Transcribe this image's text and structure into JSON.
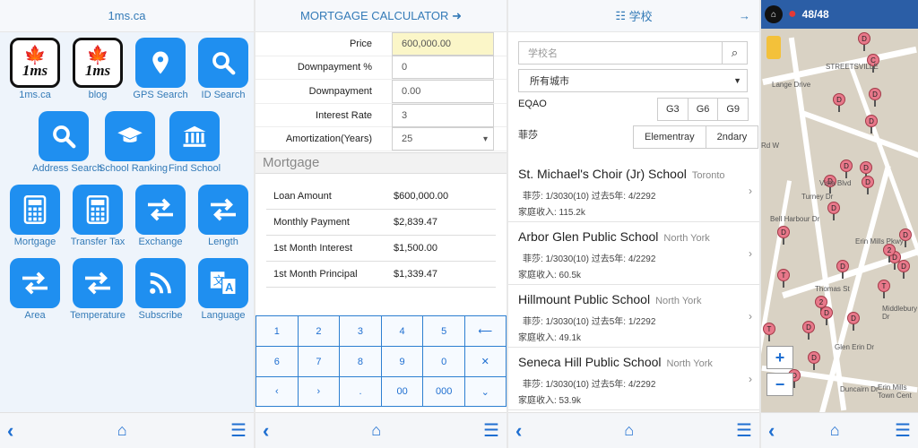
{
  "panel1": {
    "title": "1ms.ca",
    "tiles": [
      {
        "label": "1ms.ca",
        "icon": "maple-logo-icon"
      },
      {
        "label": "blog",
        "icon": "maple-logo-icon"
      },
      {
        "label": "GPS Search",
        "icon": "location-pin-icon"
      },
      {
        "label": "ID Search",
        "icon": "search-icon"
      },
      {
        "label": "Address Search",
        "icon": "search-icon"
      },
      {
        "label": "School Ranking",
        "icon": "graduation-cap-icon"
      },
      {
        "label": "Find School",
        "icon": "institution-icon"
      },
      {
        "label": "Mortgage",
        "icon": "calculator-icon"
      },
      {
        "label": "Transfer Tax",
        "icon": "calculator-icon"
      },
      {
        "label": "Exchange",
        "icon": "exchange-arrows-icon"
      },
      {
        "label": "Length",
        "icon": "exchange-arrows-icon"
      },
      {
        "label": "Area",
        "icon": "exchange-arrows-icon"
      },
      {
        "label": "Temperature",
        "icon": "exchange-arrows-icon"
      },
      {
        "label": "Subscribe",
        "icon": "rss-icon"
      },
      {
        "label": "Language",
        "icon": "translate-icon"
      }
    ],
    "logo_text": "1ms"
  },
  "panel2": {
    "title": "MORTGAGE CALCULATOR",
    "fields": [
      {
        "label": "Price",
        "value": "600,000.00"
      },
      {
        "label": "Downpayment %",
        "value": "0"
      },
      {
        "label": "Downpayment",
        "value": "0.00"
      },
      {
        "label": "Interest Rate",
        "value": "3"
      },
      {
        "label": "Amortization(Years)",
        "value": "25"
      }
    ],
    "section": "Mortgage",
    "results": [
      {
        "label": "Loan Amount",
        "value": "$600,000.00"
      },
      {
        "label": "Monthly Payment",
        "value": "$2,839.47"
      },
      {
        "label": "1st Month Interest",
        "value": "$1,500.00"
      },
      {
        "label": "1st Month Principal",
        "value": "$1,339.47"
      }
    ],
    "keys": [
      [
        "1",
        "2",
        "3",
        "4",
        "5",
        "⟵"
      ],
      [
        "6",
        "7",
        "8",
        "9",
        "0",
        "✕"
      ],
      [
        "‹",
        "›",
        ".",
        "00",
        "000",
        "⌄"
      ]
    ]
  },
  "panel3": {
    "title": "学校",
    "search_placeholder": "学校名",
    "city": "所有城市",
    "eqao_label": "EQAO",
    "grades": [
      "G3",
      "G6",
      "G9"
    ],
    "fraser_label": "菲莎",
    "levels": [
      "Elementray",
      "2ndary"
    ],
    "schools": [
      {
        "name": "St. Michael's Choir (Jr) School",
        "city": "Toronto",
        "line1": "菲莎: 1/3030(10)   过去5年: 4/2292",
        "line2": "家庭收入: 115.2k"
      },
      {
        "name": "Arbor Glen Public School",
        "city": "North York",
        "line1": "菲莎: 1/3030(10)   过去5年: 4/2292",
        "line2": "家庭收入: 60.5k"
      },
      {
        "name": "Hillmount Public School",
        "city": "North York",
        "line1": "菲莎: 1/3030(10)   过去5年: 1/2292",
        "line2": "家庭收入: 49.1k"
      },
      {
        "name": "Seneca Hill Public School",
        "city": "North York",
        "line1": "菲莎: 1/3030(10)   过去5年: 4/2292",
        "line2": "家庭收入: 53.9k"
      }
    ]
  },
  "panel4": {
    "count": "48/48",
    "labels": [
      "STREETSVILLE",
      "Thomas St",
      "Erin Mills Pkwy",
      "Glen Erin Dr",
      "Duncairn Dr",
      "Erin Mills Town Cent",
      "Vista Blvd",
      "Bell Harbour Dr",
      "Middlebury Dr",
      "Turney Dr",
      "Rd W",
      "Lange Drive"
    ],
    "pins": [
      "D",
      "C",
      "D",
      "D",
      "D",
      "D",
      "D",
      "D",
      "D",
      "D",
      "D",
      "D",
      "D",
      "D",
      "2",
      "D",
      "T",
      "T",
      "2",
      "D",
      "D",
      "D",
      "T",
      "D",
      "D"
    ]
  }
}
